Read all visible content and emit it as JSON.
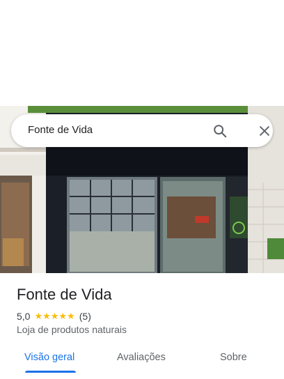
{
  "search": {
    "query": "Fonte de Vida",
    "icons": {
      "search": "search-icon",
      "close": "close-icon"
    }
  },
  "photo": {
    "sign_text": "",
    "description_hidden": true
  },
  "place": {
    "name": "Fonte de Vida",
    "rating": "5,0",
    "stars": "★★★★★",
    "review_count": "(5)",
    "category": "Loja de produtos naturais"
  },
  "tabs": [
    {
      "label": "Visão geral",
      "active": true
    },
    {
      "label": "Avaliações",
      "active": false
    },
    {
      "label": "Sobre",
      "active": false
    }
  ],
  "colors": {
    "accent": "#1a73e8",
    "star": "#fbbc04",
    "text": "#202124",
    "muted": "#5f6368"
  }
}
